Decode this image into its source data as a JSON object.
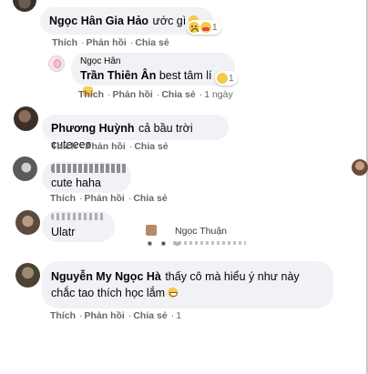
{
  "comments": [
    {
      "author": "Ngọc Hân Gia Hảo",
      "text": "ước gì",
      "actions": [
        "Thích",
        "Phản hồi",
        "Chia sẻ"
      ],
      "reactions": {
        "icons": [
          "sad-emoji",
          "care-emoji"
        ],
        "count": "1"
      }
    },
    {
      "author": "Phương Huỳnh",
      "text": "cả bầu trời cuteeee",
      "actions": [
        "Thích",
        "Phản hồi",
        "Chia sẻ"
      ]
    },
    {
      "author": "",
      "text": "cute haha",
      "actions": [
        "Thích",
        "Phản hồi",
        "Chia sẻ"
      ]
    },
    {
      "author": "",
      "text": "Ulatr",
      "actions": []
    },
    {
      "author": "Nguyễn My Ngọc Hà",
      "text": "thấy cô mà hiểu ý như này chắc tao thích học lắm",
      "actions": [
        "Thích",
        "Phản hồi",
        "Chia sẻ"
      ],
      "time": "1"
    }
  ],
  "reply": {
    "author_small": "Ngọc Hân",
    "mention": "Trần Thiên Ân",
    "text": "best tâm lí",
    "actions": [
      "Thích",
      "Phản hồi",
      "Chia sẻ"
    ],
    "time": "1 ngày",
    "reactions": {
      "icons": [
        "grin-emoji"
      ],
      "count": "1"
    }
  },
  "hover_card": {
    "name": "Ngọc Thuận"
  },
  "separator": "·",
  "colors": {
    "bubble": "#f0f2f5",
    "meta": "#65676b",
    "text": "#050505"
  }
}
